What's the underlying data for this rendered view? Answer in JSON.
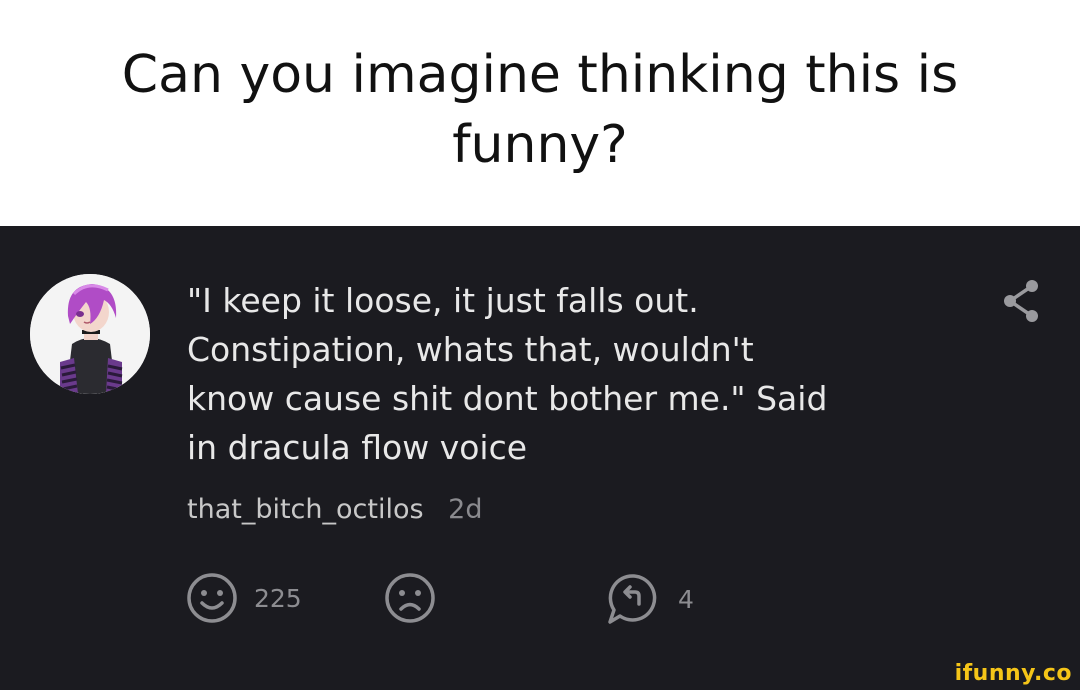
{
  "caption": {
    "line1": "Can you imagine thinking this is",
    "line2": "funny?"
  },
  "comment": {
    "lines": [
      "\"I keep it loose, it just falls out.",
      "Constipation, whats that, wouldn't",
      "know cause shit dont bother me.\" Said",
      "in dracula flow voice"
    ],
    "username": "that_bitch_octilos",
    "time": "2d",
    "smile_count": "225",
    "reply_count": "4"
  },
  "icons": {
    "share": "share-icon",
    "smile": "smile-icon",
    "frown": "frown-icon",
    "reply": "reply-icon"
  },
  "colors": {
    "panel_background": "#1b1b20",
    "text": "#e8e8e8",
    "muted": "#8d8d91",
    "watermark": "#f5c518"
  },
  "watermark": "ifunny.co"
}
